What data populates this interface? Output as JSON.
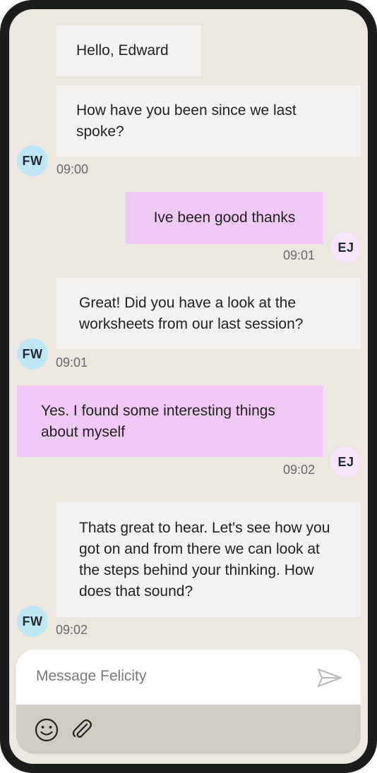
{
  "messages": [
    {
      "text": "Hello, Edward"
    },
    {
      "text": "How have you been since we last spoke?"
    },
    {
      "text": "Ive been good thanks"
    },
    {
      "text": "Great! Did you have a look at the worksheets from our last session?"
    },
    {
      "text": "Yes. I found some interesting things about myself"
    },
    {
      "text": "Thats great to hear. Let's see how you got on and from there we can look at the steps behind your thinking. How does that sound?"
    }
  ],
  "avatars": {
    "therapist": "FW",
    "user": "EJ"
  },
  "times": [
    "09:00",
    "09:01",
    "09:01",
    "09:02",
    "09:02"
  ],
  "composer": {
    "placeholder": "Message Felicity"
  },
  "icons": {
    "send": "send-icon",
    "emoji": "emoji-icon",
    "attach": "paperclip-icon"
  },
  "colors": {
    "incoming": "#f3f2f1",
    "outgoing": "#f0c8f5",
    "avatar_fw": "#bfe6f7",
    "avatar_ej": "#f7e6f9",
    "background": "#ebe6df"
  }
}
